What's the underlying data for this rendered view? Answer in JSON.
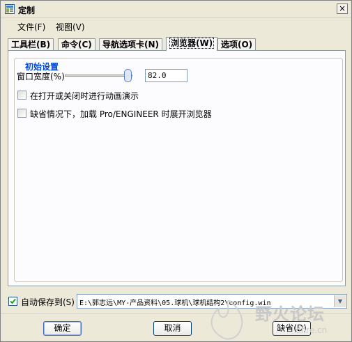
{
  "window": {
    "title": "定制",
    "close_glyph": "×"
  },
  "menubar": {
    "items": [
      {
        "label": "文件(F)"
      },
      {
        "label": "视图(V)"
      }
    ]
  },
  "tabs": [
    {
      "label": "工具栏(B)"
    },
    {
      "label": "命令(C)"
    },
    {
      "label": "导航选项卡(N)"
    },
    {
      "label": "浏览器(W)",
      "active": true
    },
    {
      "label": "选项(O)"
    }
  ],
  "group": {
    "title": "初始设置",
    "width_label": "窗口宽度(%)",
    "width_value": "82.0",
    "slider_fraction": 0.82,
    "checkbox1_label": "在打开或关闭时进行动画演示",
    "checkbox1_checked": false,
    "checkbox2_label": "缺省情况下，加载 Pro/ENGINEER 时展开浏览器",
    "checkbox2_checked": false
  },
  "autosave": {
    "label": "自动保存到(S)",
    "checked": true,
    "path": "E:\\郭志远\\MY-产品资料\\05.球机\\球机结构2\\config.win"
  },
  "buttons": {
    "ok": "确定",
    "cancel": "取消",
    "default": "缺省(D)"
  },
  "watermark": {
    "text": "野火论坛",
    "site": "dfire.cn"
  },
  "icons": [
    "window-icon",
    "close-icon",
    "combo-arrow-icon",
    "check-icon"
  ]
}
